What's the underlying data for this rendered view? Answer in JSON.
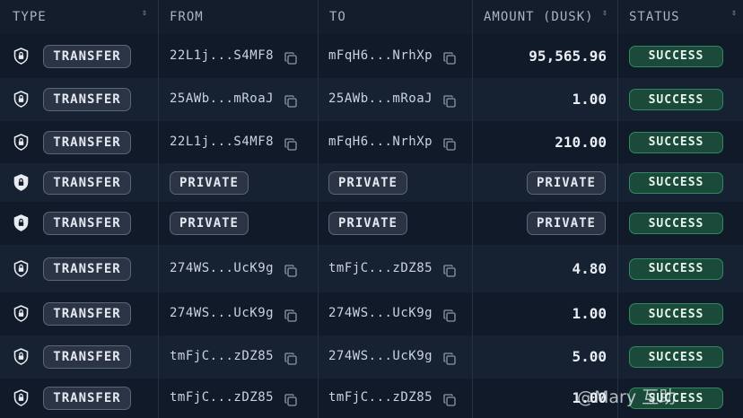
{
  "columns": {
    "type": "TYPE",
    "from": "FROM",
    "to": "TO",
    "amount": "AMOUNT (DUSK)",
    "status": "STATUS"
  },
  "icons": {
    "row_type": "shield-lock-icon",
    "copy": "copy-icon",
    "sort": "sort-icon"
  },
  "colors": {
    "background": "#101826",
    "success_bg": "#1b4a3a",
    "success_border": "#2f8a5e",
    "pill_bg": "#2a3445"
  },
  "rows": [
    {
      "type": "TRANSFER",
      "from": "22L1j...S4MF8",
      "to": "mFqH6...NrhXp",
      "amount": "95,565.96",
      "status": "SUCCESS"
    },
    {
      "type": "TRANSFER",
      "from": "25AWb...mRoaJ",
      "to": "25AWb...mRoaJ",
      "amount": "1.00",
      "status": "SUCCESS"
    },
    {
      "type": "TRANSFER",
      "from": "22L1j...S4MF8",
      "to": "mFqH6...NrhXp",
      "amount": "210.00",
      "status": "SUCCESS"
    },
    {
      "type": "TRANSFER",
      "from": "PRIVATE",
      "to": "PRIVATE",
      "amount": "PRIVATE",
      "status": "SUCCESS"
    },
    {
      "type": "TRANSFER",
      "from": "PRIVATE",
      "to": "PRIVATE",
      "amount": "PRIVATE",
      "status": "SUCCESS"
    },
    {
      "type": "TRANSFER",
      "from": "274WS...UcK9g",
      "to": "tmFjC...zDZ85",
      "amount": "4.80",
      "status": "SUCCESS"
    },
    {
      "type": "TRANSFER",
      "from": "274WS...UcK9g",
      "to": "274WS...UcK9g",
      "amount": "1.00",
      "status": "SUCCESS"
    },
    {
      "type": "TRANSFER",
      "from": "tmFjC...zDZ85",
      "to": "274WS...UcK9g",
      "amount": "5.00",
      "status": "SUCCESS"
    },
    {
      "type": "TRANSFER",
      "from": "tmFjC...zDZ85",
      "to": "tmFjC...zDZ85",
      "amount": "1.00",
      "status": "SUCCESS"
    }
  ],
  "watermark": "@Mary 互助"
}
